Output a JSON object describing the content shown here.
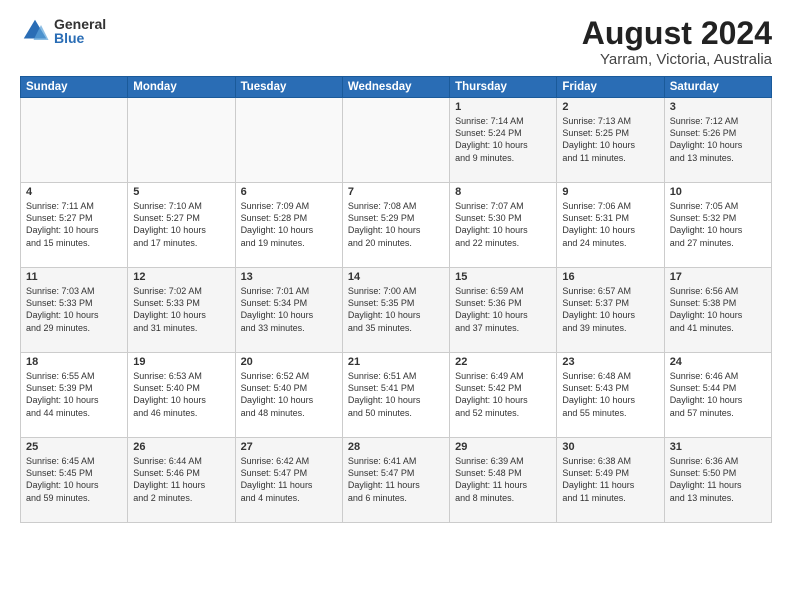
{
  "header": {
    "logo_general": "General",
    "logo_blue": "Blue",
    "title": "August 2024",
    "subtitle": "Yarram, Victoria, Australia"
  },
  "calendar": {
    "days_of_week": [
      "Sunday",
      "Monday",
      "Tuesday",
      "Wednesday",
      "Thursday",
      "Friday",
      "Saturday"
    ],
    "weeks": [
      [
        {
          "day": "",
          "info": ""
        },
        {
          "day": "",
          "info": ""
        },
        {
          "day": "",
          "info": ""
        },
        {
          "day": "",
          "info": ""
        },
        {
          "day": "1",
          "info": "Sunrise: 7:14 AM\nSunset: 5:24 PM\nDaylight: 10 hours\nand 9 minutes."
        },
        {
          "day": "2",
          "info": "Sunrise: 7:13 AM\nSunset: 5:25 PM\nDaylight: 10 hours\nand 11 minutes."
        },
        {
          "day": "3",
          "info": "Sunrise: 7:12 AM\nSunset: 5:26 PM\nDaylight: 10 hours\nand 13 minutes."
        }
      ],
      [
        {
          "day": "4",
          "info": "Sunrise: 7:11 AM\nSunset: 5:27 PM\nDaylight: 10 hours\nand 15 minutes."
        },
        {
          "day": "5",
          "info": "Sunrise: 7:10 AM\nSunset: 5:27 PM\nDaylight: 10 hours\nand 17 minutes."
        },
        {
          "day": "6",
          "info": "Sunrise: 7:09 AM\nSunset: 5:28 PM\nDaylight: 10 hours\nand 19 minutes."
        },
        {
          "day": "7",
          "info": "Sunrise: 7:08 AM\nSunset: 5:29 PM\nDaylight: 10 hours\nand 20 minutes."
        },
        {
          "day": "8",
          "info": "Sunrise: 7:07 AM\nSunset: 5:30 PM\nDaylight: 10 hours\nand 22 minutes."
        },
        {
          "day": "9",
          "info": "Sunrise: 7:06 AM\nSunset: 5:31 PM\nDaylight: 10 hours\nand 24 minutes."
        },
        {
          "day": "10",
          "info": "Sunrise: 7:05 AM\nSunset: 5:32 PM\nDaylight: 10 hours\nand 27 minutes."
        }
      ],
      [
        {
          "day": "11",
          "info": "Sunrise: 7:03 AM\nSunset: 5:33 PM\nDaylight: 10 hours\nand 29 minutes."
        },
        {
          "day": "12",
          "info": "Sunrise: 7:02 AM\nSunset: 5:33 PM\nDaylight: 10 hours\nand 31 minutes."
        },
        {
          "day": "13",
          "info": "Sunrise: 7:01 AM\nSunset: 5:34 PM\nDaylight: 10 hours\nand 33 minutes."
        },
        {
          "day": "14",
          "info": "Sunrise: 7:00 AM\nSunset: 5:35 PM\nDaylight: 10 hours\nand 35 minutes."
        },
        {
          "day": "15",
          "info": "Sunrise: 6:59 AM\nSunset: 5:36 PM\nDaylight: 10 hours\nand 37 minutes."
        },
        {
          "day": "16",
          "info": "Sunrise: 6:57 AM\nSunset: 5:37 PM\nDaylight: 10 hours\nand 39 minutes."
        },
        {
          "day": "17",
          "info": "Sunrise: 6:56 AM\nSunset: 5:38 PM\nDaylight: 10 hours\nand 41 minutes."
        }
      ],
      [
        {
          "day": "18",
          "info": "Sunrise: 6:55 AM\nSunset: 5:39 PM\nDaylight: 10 hours\nand 44 minutes."
        },
        {
          "day": "19",
          "info": "Sunrise: 6:53 AM\nSunset: 5:40 PM\nDaylight: 10 hours\nand 46 minutes."
        },
        {
          "day": "20",
          "info": "Sunrise: 6:52 AM\nSunset: 5:40 PM\nDaylight: 10 hours\nand 48 minutes."
        },
        {
          "day": "21",
          "info": "Sunrise: 6:51 AM\nSunset: 5:41 PM\nDaylight: 10 hours\nand 50 minutes."
        },
        {
          "day": "22",
          "info": "Sunrise: 6:49 AM\nSunset: 5:42 PM\nDaylight: 10 hours\nand 52 minutes."
        },
        {
          "day": "23",
          "info": "Sunrise: 6:48 AM\nSunset: 5:43 PM\nDaylight: 10 hours\nand 55 minutes."
        },
        {
          "day": "24",
          "info": "Sunrise: 6:46 AM\nSunset: 5:44 PM\nDaylight: 10 hours\nand 57 minutes."
        }
      ],
      [
        {
          "day": "25",
          "info": "Sunrise: 6:45 AM\nSunset: 5:45 PM\nDaylight: 10 hours\nand 59 minutes."
        },
        {
          "day": "26",
          "info": "Sunrise: 6:44 AM\nSunset: 5:46 PM\nDaylight: 11 hours\nand 2 minutes."
        },
        {
          "day": "27",
          "info": "Sunrise: 6:42 AM\nSunset: 5:47 PM\nDaylight: 11 hours\nand 4 minutes."
        },
        {
          "day": "28",
          "info": "Sunrise: 6:41 AM\nSunset: 5:47 PM\nDaylight: 11 hours\nand 6 minutes."
        },
        {
          "day": "29",
          "info": "Sunrise: 6:39 AM\nSunset: 5:48 PM\nDaylight: 11 hours\nand 8 minutes."
        },
        {
          "day": "30",
          "info": "Sunrise: 6:38 AM\nSunset: 5:49 PM\nDaylight: 11 hours\nand 11 minutes."
        },
        {
          "day": "31",
          "info": "Sunrise: 6:36 AM\nSunset: 5:50 PM\nDaylight: 11 hours\nand 13 minutes."
        }
      ]
    ]
  }
}
